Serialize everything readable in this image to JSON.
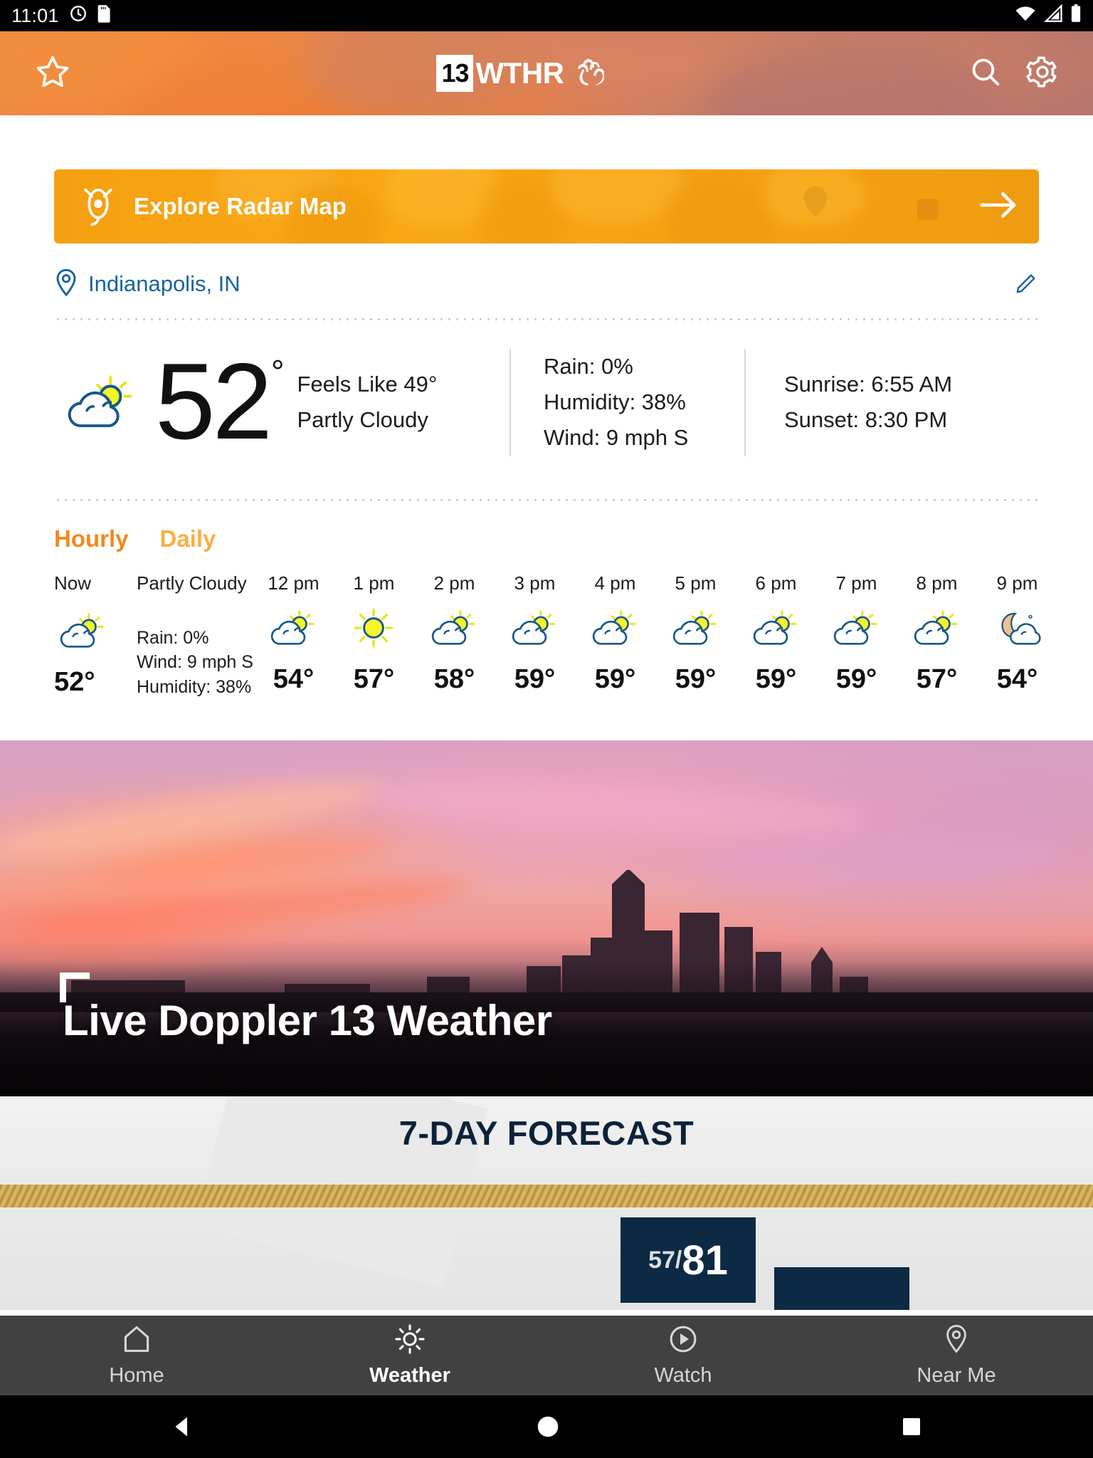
{
  "status_bar": {
    "time": "11:01",
    "left_icons": [
      "clock-icon",
      "sd-card-icon"
    ],
    "right_icons": [
      "wifi-icon",
      "cell-signal-icon",
      "battery-icon"
    ]
  },
  "header": {
    "favorite_icon": "star-outline-icon",
    "logo_number": "13",
    "logo_text": "WTHR",
    "logo_mark": "nbc-peacock-icon",
    "search_icon": "search-icon",
    "settings_icon": "gear-icon",
    "accent_color": "#e8834a"
  },
  "radar_banner": {
    "label": "Explore Radar Map",
    "icon": "radar-target-icon",
    "arrow_icon": "arrow-right-icon",
    "background_color": "#f5a012"
  },
  "location": {
    "pin_icon": "location-pin-icon",
    "name": "Indianapolis, IN",
    "edit_icon": "pencil-edit-icon",
    "link_color": "#15639e"
  },
  "current": {
    "condition_icon": "partly-cloudy-day-icon",
    "temperature": "52",
    "degree_symbol": "°",
    "feels_like": "Feels Like 49°",
    "description": "Partly Cloudy",
    "rain": "Rain: 0%",
    "humidity": "Humidity: 38%",
    "wind": "Wind: 9 mph S",
    "sunrise": "Sunrise: 6:55 AM",
    "sunset": "Sunset: 8:30 PM"
  },
  "tabs": {
    "hourly": "Hourly",
    "daily": "Daily",
    "active": "Hourly",
    "active_color": "#f08a1e",
    "inactive_color": "#fbb040"
  },
  "hourly_forecast": {
    "now": {
      "label": "Now",
      "icon": "partly-cloudy-day-icon",
      "temp": "52°",
      "condition": "Partly Cloudy",
      "rain": "Rain: 0%",
      "wind": "Wind: 9 mph S",
      "humidity": "Humidity: 38%"
    },
    "hours": [
      {
        "time": "12 pm",
        "icon": "partly-cloudy-day-icon",
        "temp": "54°"
      },
      {
        "time": "1 pm",
        "icon": "sunny-icon",
        "temp": "57°"
      },
      {
        "time": "2 pm",
        "icon": "partly-cloudy-day-icon",
        "temp": "58°"
      },
      {
        "time": "3 pm",
        "icon": "partly-cloudy-day-icon",
        "temp": "59°"
      },
      {
        "time": "4 pm",
        "icon": "partly-cloudy-day-icon",
        "temp": "59°"
      },
      {
        "time": "5 pm",
        "icon": "partly-cloudy-day-icon",
        "temp": "59°"
      },
      {
        "time": "6 pm",
        "icon": "partly-cloudy-day-icon",
        "temp": "59°"
      },
      {
        "time": "7 pm",
        "icon": "partly-cloudy-day-icon",
        "temp": "59°"
      },
      {
        "time": "8 pm",
        "icon": "partly-cloudy-day-icon",
        "temp": "57°"
      },
      {
        "time": "9 pm",
        "icon": "partly-cloudy-night-icon",
        "temp": "54°"
      }
    ]
  },
  "hero": {
    "caption": "Live Doppler 13 Weather",
    "bracket_icon": "corner-bracket-icon"
  },
  "forecast_peek": {
    "title": "7-DAY FORECAST",
    "card_low": "57",
    "card_high": "81"
  },
  "bottom_nav": {
    "items": [
      {
        "label": "Home",
        "icon": "home-icon",
        "active": false
      },
      {
        "label": "Weather",
        "icon": "sun-icon",
        "active": true
      },
      {
        "label": "Watch",
        "icon": "play-circle-icon",
        "active": false
      },
      {
        "label": "Near Me",
        "icon": "location-pin-icon",
        "active": false
      }
    ]
  },
  "system_nav": {
    "back": "back-triangle-icon",
    "home": "home-circle-icon",
    "recents": "recents-square-icon"
  }
}
